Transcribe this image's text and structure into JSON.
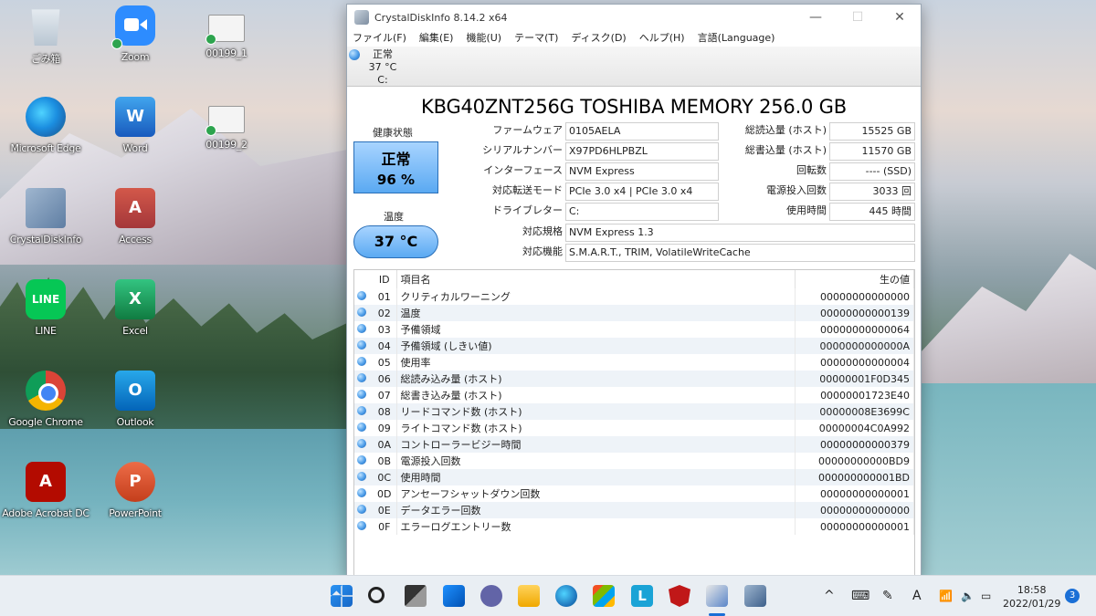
{
  "desktop": {
    "icons": [
      {
        "label": "ごみ箱",
        "icon": "recycle-bin-icon"
      },
      {
        "label": "Zoom",
        "icon": "zoom-icon"
      },
      {
        "label": "00199_1",
        "icon": "file-icon"
      },
      {
        "label": "Microsoft Edge",
        "icon": "edge-icon"
      },
      {
        "label": "Word",
        "icon": "word-icon"
      },
      {
        "label": "00199_2",
        "icon": "file-icon"
      },
      {
        "label": "CrystalDiskInfo",
        "icon": "crystaldiskinfo-icon"
      },
      {
        "label": "Access",
        "icon": "access-icon"
      },
      {
        "label": "LINE",
        "icon": "line-icon"
      },
      {
        "label": "Excel",
        "icon": "excel-icon"
      },
      {
        "label": "Google Chrome",
        "icon": "chrome-icon"
      },
      {
        "label": "Outlook",
        "icon": "outlook-icon"
      },
      {
        "label": "Adobe Acrobat DC",
        "icon": "acrobat-icon"
      },
      {
        "label": "PowerPoint",
        "icon": "powerpoint-icon"
      }
    ]
  },
  "window": {
    "title": "CrystalDiskInfo 8.14.2 x64",
    "minimize": "—",
    "maximize": "☐",
    "close": "✕",
    "menu": [
      "ファイル(F)",
      "編集(E)",
      "機能(U)",
      "テーマ(T)",
      "ディスク(D)",
      "ヘルプ(H)",
      "言語(Language)"
    ],
    "drive_tab": {
      "status": "正常",
      "temp": "37 °C",
      "letter": "C:"
    },
    "model": "KBG40ZNT256G TOSHIBA MEMORY 256.0 GB",
    "health": {
      "label": "健康状態",
      "status": "正常",
      "percent": "96 %",
      "color": "#5aa9f2"
    },
    "temperature": {
      "label": "温度",
      "value": "37 °C"
    },
    "fields_left": [
      {
        "label": "ファームウェア",
        "value": "0105AELA"
      },
      {
        "label": "シリアルナンバー",
        "value": "X97PD6HLPBZL"
      },
      {
        "label": "インターフェース",
        "value": "NVM Express"
      },
      {
        "label": "対応転送モード",
        "value": "PCIe 3.0 x4 | PCIe 3.0 x4"
      },
      {
        "label": "ドライブレター",
        "value": "C:"
      }
    ],
    "fields_right": [
      {
        "label": "総読込量 (ホスト)",
        "value": "15525 GB"
      },
      {
        "label": "総書込量 (ホスト)",
        "value": "11570 GB"
      },
      {
        "label": "回転数",
        "value": "---- (SSD)"
      },
      {
        "label": "電源投入回数",
        "value": "3033 回"
      },
      {
        "label": "使用時間",
        "value": "445 時間"
      }
    ],
    "fields_wide": [
      {
        "label": "対応規格",
        "value": "NVM Express 1.3"
      },
      {
        "label": "対応機能",
        "value": "S.M.A.R.T., TRIM, VolatileWriteCache"
      }
    ],
    "smart": {
      "headers": [
        "ID",
        "項目名",
        "生の値"
      ],
      "rows": [
        {
          "id": "01",
          "name": "クリティカルワーニング",
          "raw": "00000000000000"
        },
        {
          "id": "02",
          "name": "温度",
          "raw": "00000000000139"
        },
        {
          "id": "03",
          "name": "予備領域",
          "raw": "00000000000064"
        },
        {
          "id": "04",
          "name": "予備領域 (しきい値)",
          "raw": "0000000000000A"
        },
        {
          "id": "05",
          "name": "使用率",
          "raw": "00000000000004"
        },
        {
          "id": "06",
          "name": "総読み込み量 (ホスト)",
          "raw": "00000001F0D345"
        },
        {
          "id": "07",
          "name": "総書き込み量 (ホスト)",
          "raw": "00000001723E40"
        },
        {
          "id": "08",
          "name": "リードコマンド数 (ホスト)",
          "raw": "00000008E3699C"
        },
        {
          "id": "09",
          "name": "ライトコマンド数 (ホスト)",
          "raw": "00000004C0A992"
        },
        {
          "id": "0A",
          "name": "コントローラービジー時間",
          "raw": "00000000000379"
        },
        {
          "id": "0B",
          "name": "電源投入回数",
          "raw": "00000000000BD9"
        },
        {
          "id": "0C",
          "name": "使用時間",
          "raw": "000000000001BD"
        },
        {
          "id": "0D",
          "name": "アンセーフシャットダウン回数",
          "raw": "00000000000001"
        },
        {
          "id": "0E",
          "name": "データエラー回数",
          "raw": "00000000000000"
        },
        {
          "id": "0F",
          "name": "エラーログエントリー数",
          "raw": "00000000000001"
        }
      ]
    }
  },
  "taskbar": {
    "apps": [
      "start-icon",
      "search-icon",
      "task-view-icon",
      "widgets-icon",
      "teams-chat-icon",
      "file-explorer-icon",
      "edge-icon",
      "store-icon",
      "l-app-icon",
      "mcafee-icon",
      "snipping-tool-icon",
      "crystaldiskinfo-icon"
    ],
    "tray": {
      "chevron": "^",
      "keyboard": "⌨",
      "pen": "✎",
      "ime": "A",
      "wifi": "wifi-icon",
      "volume": "volume-icon",
      "battery": "battery-icon"
    },
    "time": "18:58",
    "date": "2022/01/29",
    "notifications": "3"
  }
}
